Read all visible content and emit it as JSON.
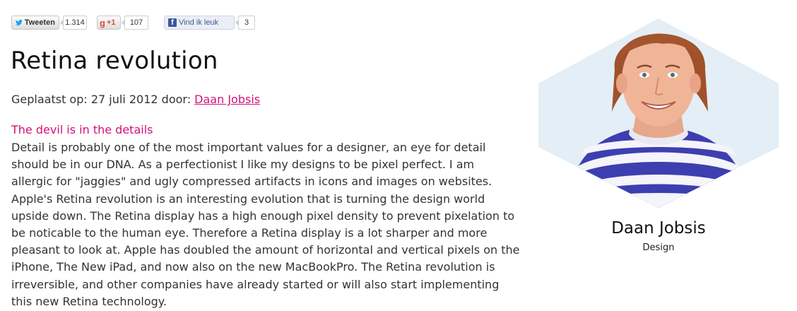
{
  "social": {
    "tweet_label": "Tweeten",
    "tweet_count": "1.314",
    "gplus_label": "+1",
    "gplus_count": "107",
    "fb_label": "Vind ik leuk",
    "fb_count": "3"
  },
  "article": {
    "title": "Retina revolution",
    "meta_prefix": "Geplaatst op: 27 juli 2012 door:",
    "author_link": "Daan Jobsis",
    "subheading": "The devil is in the details",
    "lines": [
      "Detail is probably one of the most important values for a designer, an eye for detail",
      "should be in our DNA. As a perfectionist I like my designs to be pixel perfect. I am",
      "allergic for \"jaggies\" and ugly compressed artifacts in icons and images on websites.",
      "Apple's Retina revolution is an interesting evolution that is turning the design world",
      "upside down. The Retina display has a high enough pixel density to prevent pixelation to",
      "be noticable to the human eye. Therefore a Retina display is a lot sharper and more",
      "pleasant to look at. Apple has doubled the amount of horizontal and vertical pixels on the",
      "iPhone, The New iPad, and now also on the new MacBookPro. The Retina revolution is",
      "irreversible, and other companies have already started or will also start implementing",
      "this new Retina technology."
    ]
  },
  "author": {
    "name": "Daan Jobsis",
    "role": "Design"
  },
  "colors": {
    "accent": "#d3107a",
    "hexagon": "#e3eef6",
    "facebook": "#3b5998",
    "twitter": "#1da1f2"
  },
  "icons": [
    "twitter-icon",
    "google-plus-icon",
    "facebook-icon"
  ]
}
